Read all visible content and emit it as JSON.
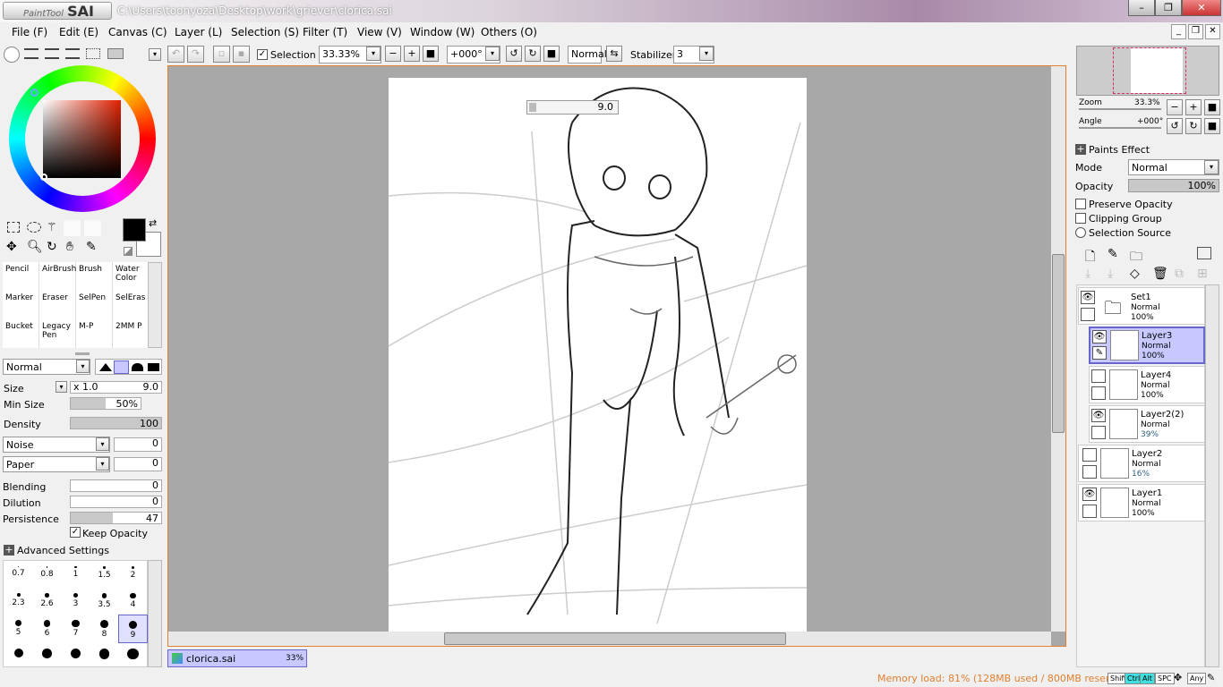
{
  "app": {
    "logo_small": "PaintTool",
    "logo_big": "SAI",
    "title": "C:\\Users\\toonyoza\\Desktop\\work\\griever\\clorica.sai"
  },
  "menu": [
    "File (F)",
    "Edit (E)",
    "Canvas (C)",
    "Layer (L)",
    "Selection (S)",
    "Filter (T)",
    "View (V)",
    "Window (W)",
    "Others (O)"
  ],
  "toolbar": {
    "selection_label": "Selection",
    "zoom": "33.33%",
    "angle": "+000°",
    "blend": "Normal",
    "stabilizer_label": "Stabilizer",
    "stabilizer": "3"
  },
  "canvas": {
    "brush_size_readout": "9.0",
    "tab_name": "clorica.sai",
    "tab_zoom": "33%"
  },
  "tools": [
    {
      "name": "Pencil"
    },
    {
      "name": "AirBrush"
    },
    {
      "name": "Brush"
    },
    {
      "name": "Water Color"
    },
    {
      "name": "Marker"
    },
    {
      "name": "Eraser"
    },
    {
      "name": "SelPen"
    },
    {
      "name": "SelEras"
    },
    {
      "name": "Bucket"
    },
    {
      "name": "Legacy Pen"
    },
    {
      "name": "M-P"
    },
    {
      "name": "2MM P"
    }
  ],
  "brush": {
    "mode": "Normal",
    "size_label": "Size",
    "size_mult": "x 1.0",
    "size": "9.0",
    "min_size_label": "Min Size",
    "min_size": "50%",
    "min_size_fraction": 0.5,
    "density_label": "Density",
    "density": "100",
    "density_fraction": 1.0,
    "noise": "Noise",
    "noise_val": "0",
    "paper": "Paper",
    "paper_val": "0",
    "blending_label": "Blending",
    "blending": "0",
    "dilution_label": "Dilution",
    "dilution": "0",
    "persistence_label": "Persistence",
    "persistence": "47",
    "persistence_fraction": 0.47,
    "keep_opacity": "Keep Opacity",
    "advanced": "Advanced Settings"
  },
  "brush_sizes": [
    "0.7",
    "0.8",
    "1",
    "1.5",
    "2",
    "2.3",
    "2.6",
    "3",
    "3.5",
    "4",
    "5",
    "6",
    "7",
    "8",
    "9",
    "",
    "",
    "",
    "",
    ""
  ],
  "navigator": {
    "zoom_label": "Zoom",
    "zoom": "33.3%",
    "angle_label": "Angle",
    "angle": "+000°"
  },
  "layer_panel": {
    "paints_effect": "Paints Effect",
    "mode_label": "Mode",
    "mode": "Normal",
    "opacity_label": "Opacity",
    "opacity": "100%",
    "preserve": "Preserve Opacity",
    "clipping": "Clipping Group",
    "selsource": "Selection Source"
  },
  "layers": [
    {
      "name": "Set1",
      "mode": "Normal",
      "opacity": "100%"
    },
    {
      "name": "Layer3",
      "mode": "Normal",
      "opacity": "100%"
    },
    {
      "name": "Layer4",
      "mode": "Normal",
      "opacity": "100%"
    },
    {
      "name": "Layer2(2)",
      "mode": "Normal",
      "opacity": "39%"
    },
    {
      "name": "Layer2",
      "mode": "Normal",
      "opacity": "16%"
    },
    {
      "name": "Layer1",
      "mode": "Normal",
      "opacity": "100%"
    }
  ],
  "status": {
    "memory": "Memory load: 81% (128MB used / 800MB reserved)",
    "keys": [
      "Shift",
      "Ctrl",
      "Alt",
      "SPC",
      "Any"
    ]
  },
  "colors": {
    "accent": "#e08030",
    "selected_layer": "#c8c8ff",
    "foreground": "#000000"
  }
}
